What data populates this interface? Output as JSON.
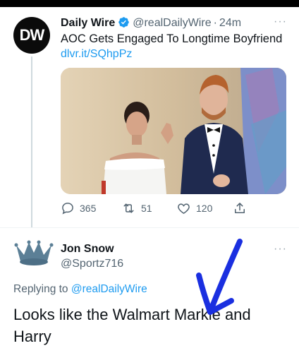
{
  "tweet": {
    "author_name": "Daily Wire",
    "avatar_text": "DW",
    "handle": "@realDailyWire",
    "separator": "·",
    "time": "24m",
    "text": "AOC Gets Engaged To Longtime Boyfriend",
    "link": "dlvr.it/SQhpPz",
    "counts": {
      "replies": "365",
      "retweets": "51",
      "likes": "120"
    },
    "icons": [
      "verified-icon",
      "more-icon",
      "reply-icon",
      "retweet-icon",
      "like-icon",
      "share-icon"
    ]
  },
  "reply": {
    "author_name": "Jon Snow",
    "handle": "@Sportz716",
    "replying_prefix": "Replying to",
    "replying_to": "@realDailyWire",
    "text": "Looks like the Walmart Markle and Harry",
    "icons": [
      "crown-avatar-icon",
      "more-icon"
    ]
  },
  "colors": {
    "accent": "#1d9bf0",
    "muted": "#536471",
    "annotation": "#1a2fe0"
  }
}
